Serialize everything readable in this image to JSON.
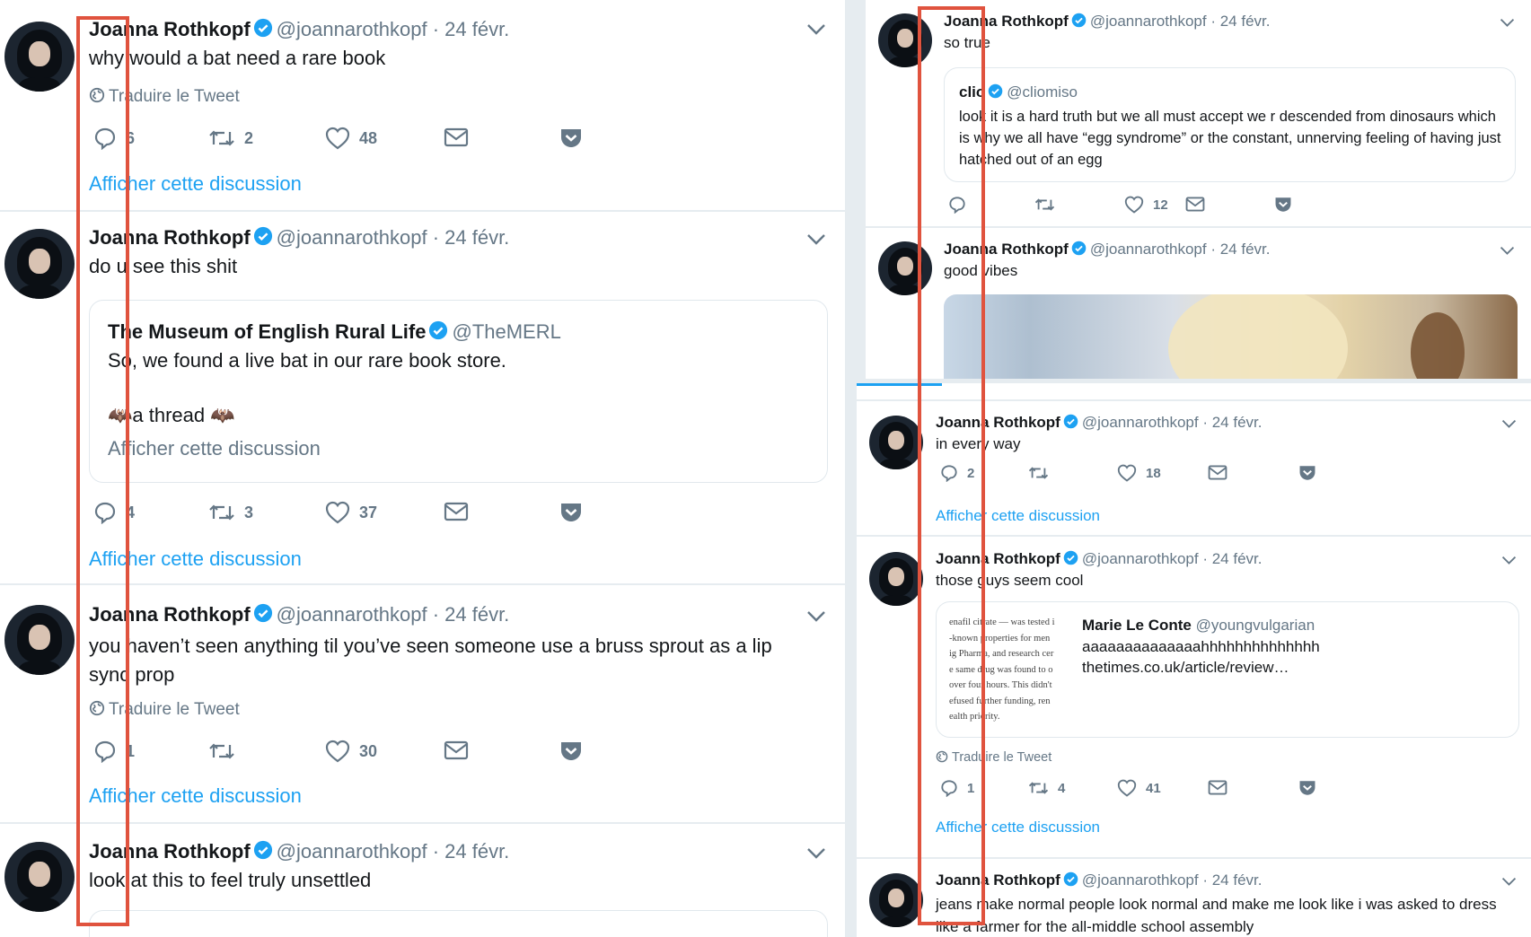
{
  "colors": {
    "accent": "#1da1f2",
    "muted": "#657786",
    "annotation": "#e0533e",
    "pocket": "#cb2f44"
  },
  "icons": {
    "reply": "reply-icon",
    "retweet": "retweet-icon",
    "like": "heart-icon",
    "dm": "envelope-icon",
    "pocket": "pocket-icon",
    "verified": "verified-badge-icon",
    "caret": "chevron-down-icon"
  },
  "author": {
    "name": "Joanna Rothkopf",
    "handle": "@joannarothkopf",
    "separator": "·",
    "date": "24 févr."
  },
  "labels": {
    "translate": "Traduire le Tweet",
    "show_thread": "Afficher cette discussion"
  },
  "left_tweets": [
    {
      "text": "why would a bat need a rare book",
      "replies": "6",
      "retweets": "2",
      "likes": "48"
    },
    {
      "text": "do u see this shit",
      "quote": {
        "name": "The Museum of English Rural Life",
        "handle": "@TheMERL",
        "line1": "So, we found a live bat in our rare book store.",
        "line2": "🦇a thread 🦇",
        "show": "Afficher cette discussion"
      },
      "replies": "4",
      "retweets": "3",
      "likes": "37"
    },
    {
      "text": "you haven’t seen anything til you’ve seen someone use a bruss sprout as a lip sync prop",
      "replies": "1",
      "retweets": "",
      "likes": "30"
    },
    {
      "text": "look at this to feel truly unsettled"
    }
  ],
  "right_top_tweets": [
    {
      "text": "so true",
      "quote": {
        "name": "clio",
        "handle": "@cliomiso",
        "text": "look it is a hard truth but we all must accept we r descended from dinosaurs which is why we all have “egg syndrome” or the constant, unnerving feeling of having just hatched out of an egg"
      },
      "replies": "",
      "retweets": "",
      "likes": "12"
    },
    {
      "text": "good vibes"
    }
  ],
  "right_bottom_tweets": [
    {
      "text": "in every way",
      "replies": "2",
      "retweets": "",
      "likes": "18"
    },
    {
      "text": "those guys seem cool",
      "card": {
        "name": "Marie Le Conte",
        "handle": "@youngvulgarian",
        "text": "aaaaaaaaaaaaaahhhhhhhhhhhhhh",
        "link": "thetimes.co.uk/article/review…",
        "thumb_lines": [
          "enafil citrate — was tested i",
          "-known properties for men",
          "ig Pharma, and research cer",
          "e same drug was found to o",
          "over four hours. This didn't",
          "efused further funding, ren",
          "ealth priority."
        ]
      },
      "replies": "1",
      "retweets": "4",
      "likes": "41"
    },
    {
      "text": "jeans make normal people look normal and make me look like i was asked to dress like a farmer for the all-middle school assembly"
    }
  ]
}
